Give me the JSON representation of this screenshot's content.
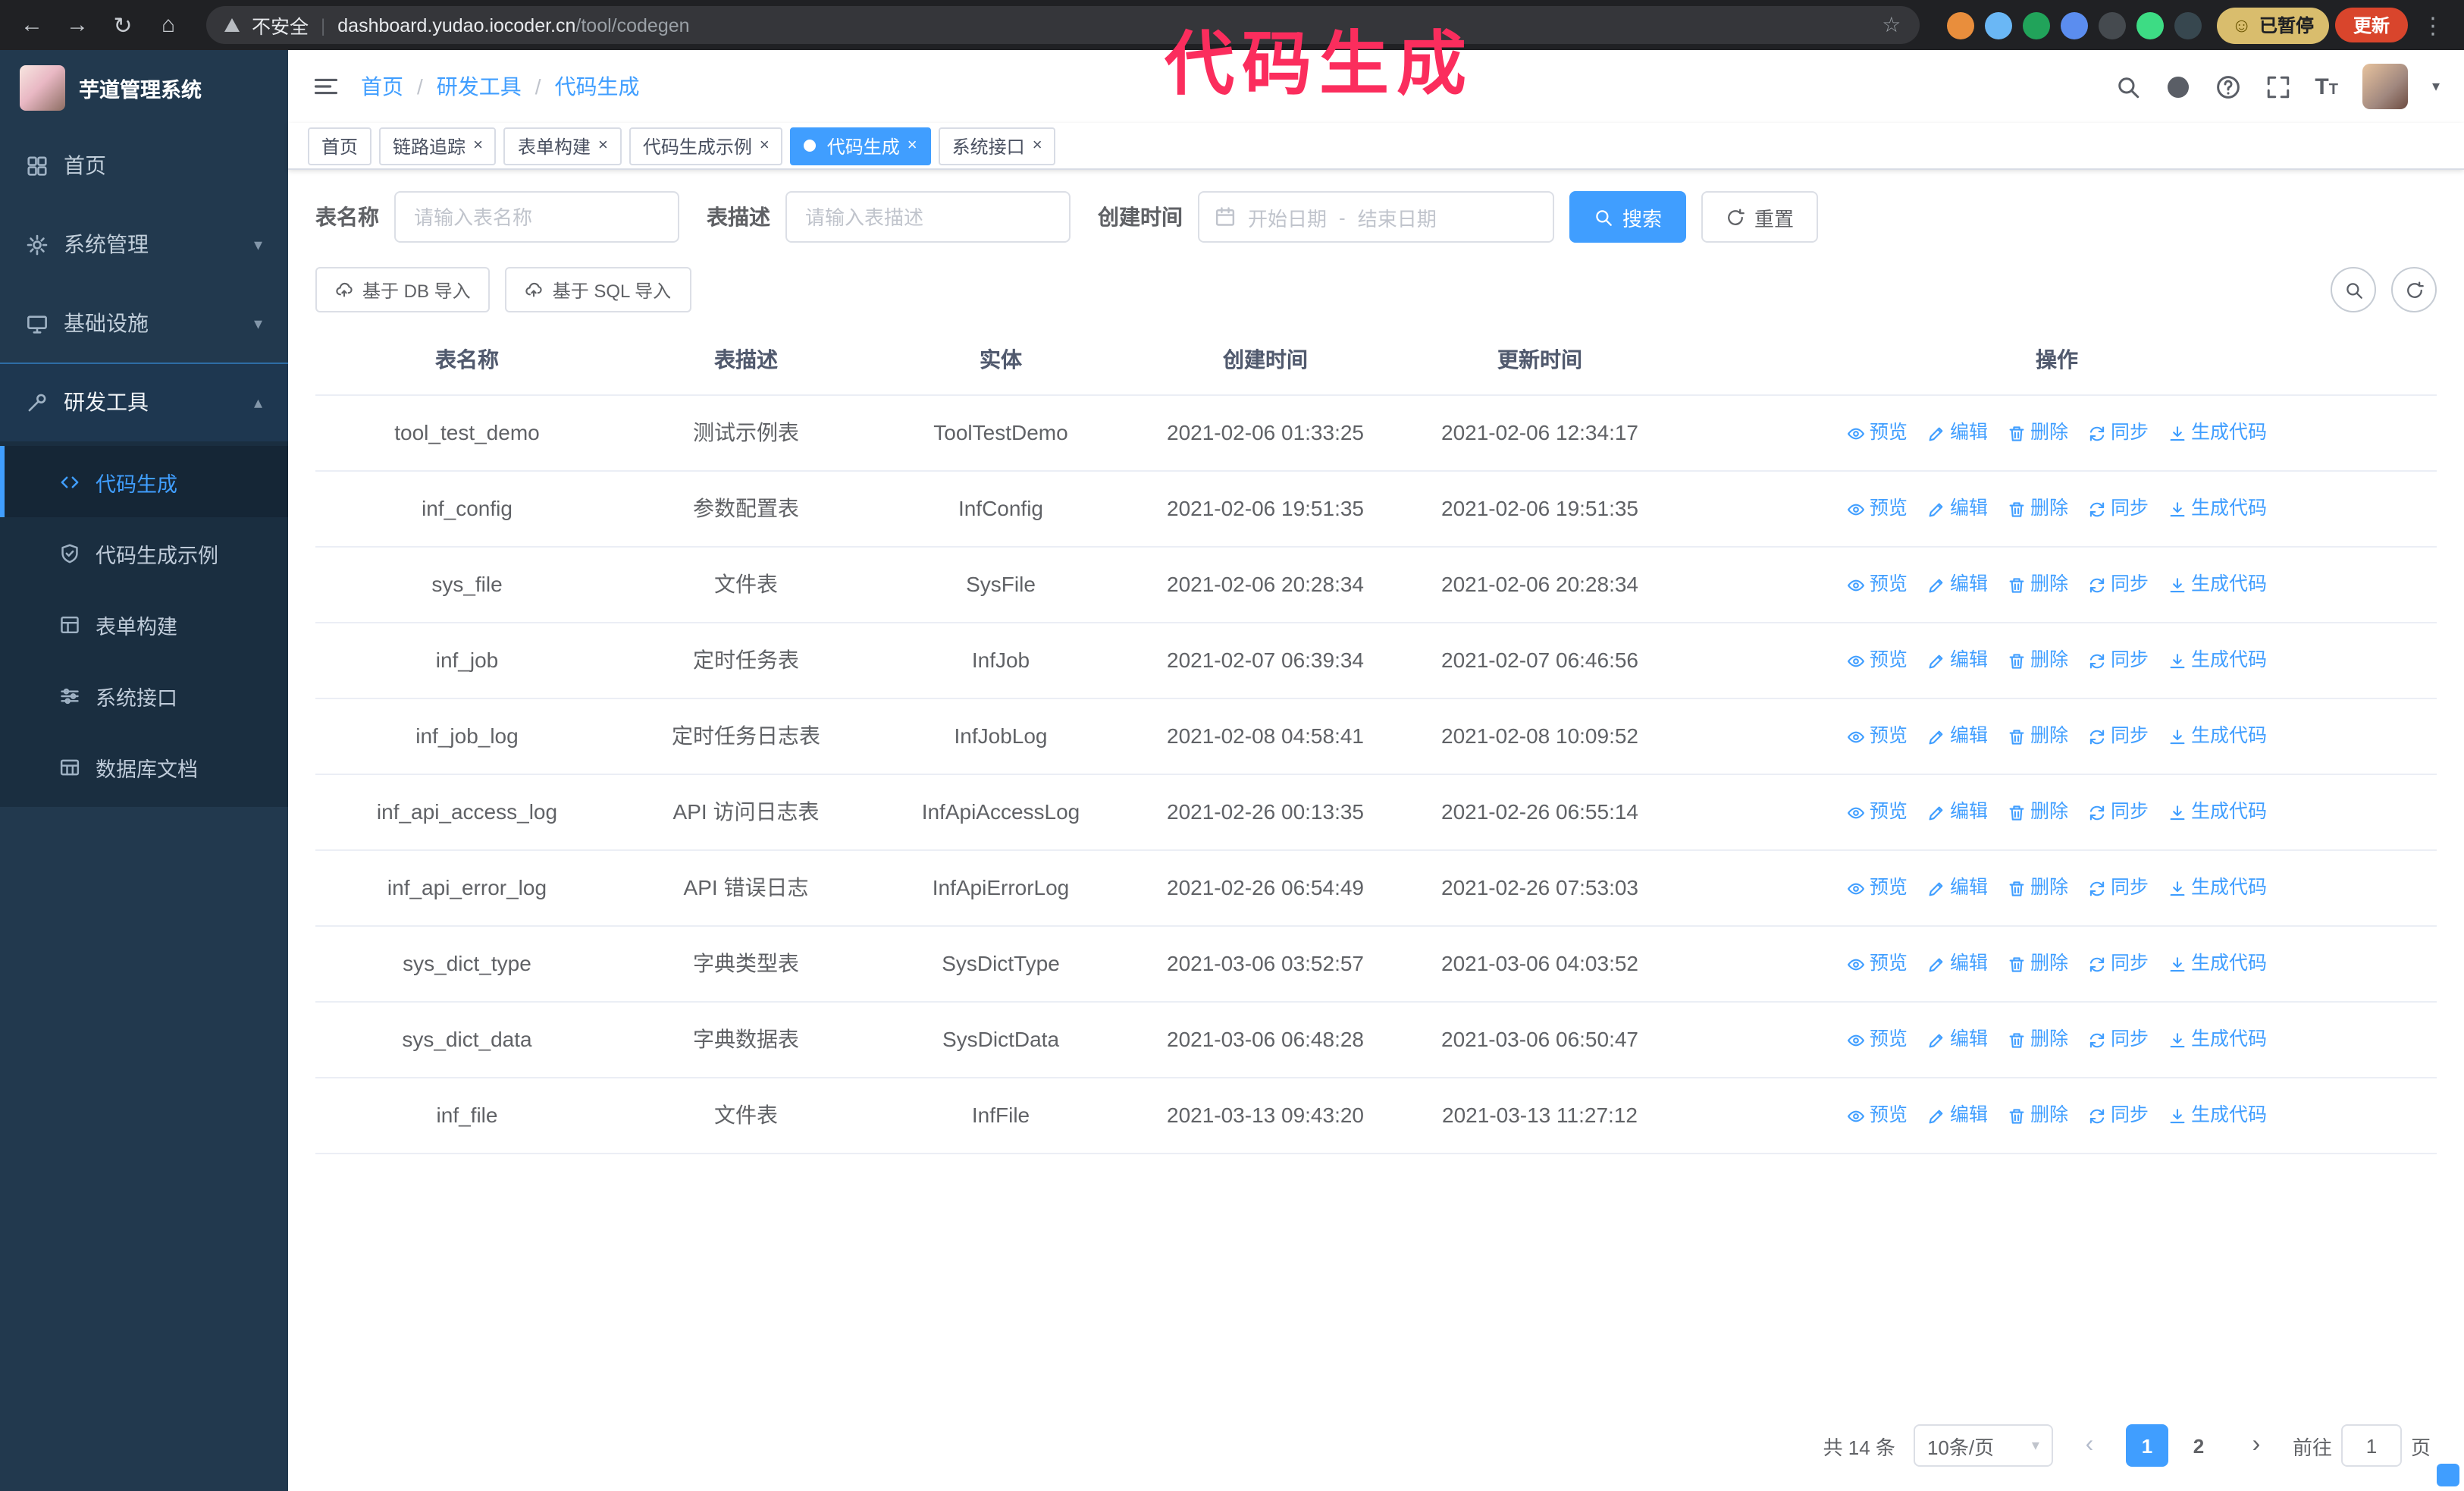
{
  "annotation": {
    "text": "代码生成",
    "color": "#fb2d5d"
  },
  "browser": {
    "back": "←",
    "forward": "→",
    "reload": "↻",
    "home": "⌂",
    "security_label": "不安全",
    "url_host": "dashboard.yudao.iocoder.cn",
    "url_path": "/tool/codegen",
    "star": "☆",
    "profile_badge": "已暂停",
    "update_label": "更新",
    "menu": "⋮",
    "extensions": [
      {
        "name": "ext-fox",
        "color": "#e98e3c"
      },
      {
        "name": "ext-drop",
        "color": "#6ab7f5"
      },
      {
        "name": "ext-check",
        "color": "#21a35a"
      },
      {
        "name": "ext-people",
        "color": "#5b8def"
      },
      {
        "name": "ext-wallet",
        "color": "#454a4f"
      },
      {
        "name": "ext-leaf",
        "color": "#3ddc84"
      },
      {
        "name": "ext-paw",
        "color": "#37474f"
      }
    ]
  },
  "sidebar": {
    "app_title": "芋道管理系统",
    "items": [
      {
        "label": "首页",
        "icon": "dashboard"
      },
      {
        "label": "系统管理",
        "icon": "gear",
        "chevron": "down"
      },
      {
        "label": "基础设施",
        "icon": "monitor",
        "chevron": "down"
      },
      {
        "label": "研发工具",
        "icon": "wrench",
        "chevron": "up",
        "open": true,
        "children": [
          {
            "label": "代码生成",
            "icon": "code",
            "active": true
          },
          {
            "label": "代码生成示例",
            "icon": "shield"
          },
          {
            "label": "表单构建",
            "icon": "form"
          },
          {
            "label": "系统接口",
            "icon": "sliders"
          },
          {
            "label": "数据库文档",
            "icon": "tabledoc"
          }
        ]
      }
    ]
  },
  "header": {
    "breadcrumb": [
      "首页",
      "研发工具",
      "代码生成"
    ]
  },
  "tabs": [
    {
      "label": "首页",
      "closable": false
    },
    {
      "label": "链路追踪",
      "closable": true
    },
    {
      "label": "表单构建",
      "closable": true
    },
    {
      "label": "代码生成示例",
      "closable": true
    },
    {
      "label": "代码生成",
      "closable": true,
      "active": true
    },
    {
      "label": "系统接口",
      "closable": true
    }
  ],
  "filters": {
    "table_name_label": "表名称",
    "table_name_placeholder": "请输入表名称",
    "table_desc_label": "表描述",
    "table_desc_placeholder": "请输入表描述",
    "create_time_label": "创建时间",
    "date_start_placeholder": "开始日期",
    "date_separator": "-",
    "date_end_placeholder": "结束日期",
    "search_button": "搜索",
    "reset_button": "重置"
  },
  "toolbar": {
    "import_db": "基于 DB 导入",
    "import_sql": "基于 SQL 导入"
  },
  "table": {
    "columns": [
      "表名称",
      "表描述",
      "实体",
      "创建时间",
      "更新时间",
      "操作"
    ],
    "actions": [
      {
        "label": "预览",
        "icon": "eye",
        "name": "preview"
      },
      {
        "label": "编辑",
        "icon": "pencil",
        "name": "edit"
      },
      {
        "label": "删除",
        "icon": "trash",
        "name": "delete"
      },
      {
        "label": "同步",
        "icon": "sync",
        "name": "sync"
      },
      {
        "label": "生成代码",
        "icon": "download",
        "name": "generate-code"
      }
    ],
    "rows": [
      {
        "name": "tool_test_demo",
        "desc": "测试示例表",
        "entity": "ToolTestDemo",
        "created": "2021-02-06 01:33:25",
        "updated": "2021-02-06 12:34:17"
      },
      {
        "name": "inf_config",
        "desc": "参数配置表",
        "entity": "InfConfig",
        "created": "2021-02-06 19:51:35",
        "updated": "2021-02-06 19:51:35"
      },
      {
        "name": "sys_file",
        "desc": "文件表",
        "entity": "SysFile",
        "created": "2021-02-06 20:28:34",
        "updated": "2021-02-06 20:28:34"
      },
      {
        "name": "inf_job",
        "desc": "定时任务表",
        "entity": "InfJob",
        "created": "2021-02-07 06:39:34",
        "updated": "2021-02-07 06:46:56"
      },
      {
        "name": "inf_job_log",
        "desc": "定时任务日志表",
        "entity": "InfJobLog",
        "created": "2021-02-08 04:58:41",
        "updated": "2021-02-08 10:09:52"
      },
      {
        "name": "inf_api_access_log",
        "desc": "API 访问日志表",
        "entity": "InfApiAccessLog",
        "created": "2021-02-26 00:13:35",
        "updated": "2021-02-26 06:55:14"
      },
      {
        "name": "inf_api_error_log",
        "desc": "API 错误日志",
        "entity": "InfApiErrorLog",
        "created": "2021-02-26 06:54:49",
        "updated": "2021-02-26 07:53:03"
      },
      {
        "name": "sys_dict_type",
        "desc": "字典类型表",
        "entity": "SysDictType",
        "created": "2021-03-06 03:52:57",
        "updated": "2021-03-06 04:03:52"
      },
      {
        "name": "sys_dict_data",
        "desc": "字典数据表",
        "entity": "SysDictData",
        "created": "2021-03-06 06:48:28",
        "updated": "2021-03-06 06:50:47"
      },
      {
        "name": "inf_file",
        "desc": "文件表",
        "entity": "InfFile",
        "created": "2021-03-13 09:43:20",
        "updated": "2021-03-13 11:27:12"
      }
    ]
  },
  "pagination": {
    "total": "共 14 条",
    "page_size": "10条/页",
    "prev": "‹",
    "next": "›",
    "pages": [
      "1",
      "2"
    ],
    "active_page": "1",
    "goto_label": "前往",
    "goto_value": "1",
    "goto_suffix": "页"
  }
}
